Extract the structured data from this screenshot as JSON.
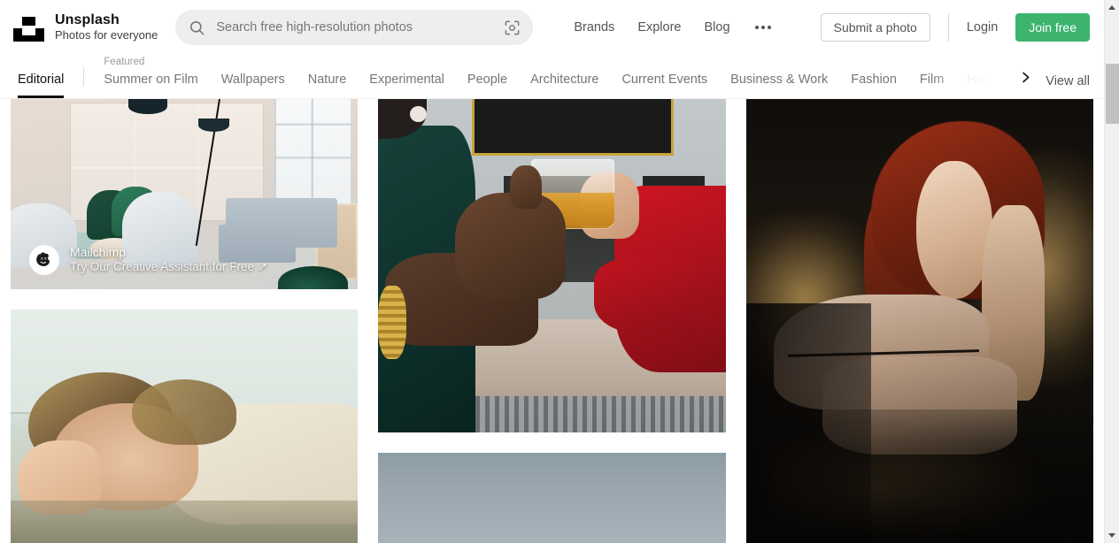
{
  "brand": {
    "name": "Unsplash",
    "tagline": "Photos for everyone",
    "logo_icon": "unsplash-logo-icon"
  },
  "search": {
    "placeholder": "Search free high-resolution photos",
    "value": "",
    "search_icon": "search-icon",
    "visual_search_icon": "visual-search-camera-icon"
  },
  "header": {
    "links": [
      {
        "label": "Brands"
      },
      {
        "label": "Explore"
      },
      {
        "label": "Blog"
      }
    ],
    "more_icon": "ellipsis-icon",
    "submit_label": "Submit a photo",
    "login_label": "Login",
    "join_label": "Join free",
    "join_color": "#3cb46e"
  },
  "catnav": {
    "editorial_label": "Editorial",
    "featured_label": "Featured",
    "items": [
      {
        "label": "Summer on Film",
        "featured": true,
        "dimmed": false
      },
      {
        "label": "Wallpapers",
        "featured": false,
        "dimmed": false
      },
      {
        "label": "Nature",
        "featured": false,
        "dimmed": false
      },
      {
        "label": "Experimental",
        "featured": false,
        "dimmed": false
      },
      {
        "label": "People",
        "featured": false,
        "dimmed": false
      },
      {
        "label": "Architecture",
        "featured": false,
        "dimmed": false
      },
      {
        "label": "Current Events",
        "featured": false,
        "dimmed": false
      },
      {
        "label": "Business & Work",
        "featured": false,
        "dimmed": false
      },
      {
        "label": "Fashion",
        "featured": false,
        "dimmed": false
      },
      {
        "label": "Film",
        "featured": false,
        "dimmed": false
      },
      {
        "label": "Health & Wellness",
        "featured": false,
        "dimmed": true
      }
    ],
    "next_icon": "chevron-right-icon",
    "view_all_label": "View all"
  },
  "grid": {
    "columns": [
      {
        "photos": [
          {
            "id": "office-interior",
            "alt": "Modern office lounge with grey armchairs, green chairs and floor lamp",
            "sponsored": {
              "brand": "Mailchimp",
              "tagline": "Try Our Creative Assistant for Free ↗",
              "logo_icon": "mailchimp-freddie-icon"
            }
          },
          {
            "id": "woman-floating-water",
            "alt": "Woman with wet hair resting her head on her hand in shallow water"
          }
        ]
      },
      {
        "photos": [
          {
            "id": "hand-holding-whisky-glass",
            "alt": "Hand with gold bracelet holding a whisky tumbler, person in red coat nearby"
          },
          {
            "id": "grey-sky",
            "alt": "Overcast grey-blue sky"
          }
        ]
      },
      {
        "photos": [
          {
            "id": "red-haired-woman-field",
            "alt": "Red-haired woman resting her head on her arm in a golden field at dusk"
          }
        ]
      }
    ]
  },
  "scrollbar": {
    "up_icon": "scroll-up-arrow-icon",
    "down_icon": "scroll-down-arrow-icon",
    "thumb": "scrollbar-thumb"
  }
}
